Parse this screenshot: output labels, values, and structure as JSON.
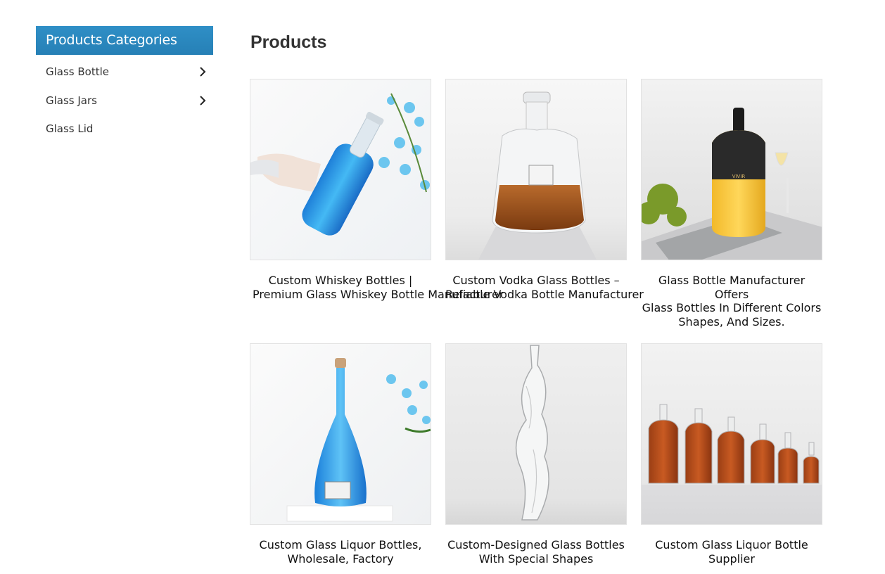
{
  "sidebar": {
    "title": "Products Categories",
    "items": [
      {
        "label": "Glass Bottle",
        "has_children": true
      },
      {
        "label": "Glass Jars",
        "has_children": true
      },
      {
        "label": "Glass Lid",
        "has_children": false
      }
    ]
  },
  "main": {
    "title": "Products",
    "products": [
      {
        "line1": "Custom Whiskey Bottles |",
        "line2": "Premium Glass Whiskey Bottle Manufacturer",
        "line3": "",
        "image": "blue-liquid-bottle-in-hand"
      },
      {
        "line1": "Custom Vodka Glass Bottles –",
        "line2": "Reliable Vodka Bottle Manufacturer",
        "line3": "",
        "image": "flat-decanter-with-amber-liquid"
      },
      {
        "line1": "Glass Bottle Manufacturer Offers",
        "line2": "Glass Bottles In Different Colors",
        "line3": "Shapes, And Sizes.",
        "image": "black-and-yellow-bottle-vivir"
      },
      {
        "line1": "Custom Glass Liquor Bottles,",
        "line2": "Wholesale, Factory",
        "line3": "",
        "image": "tall-blue-bottle-with-cork"
      },
      {
        "line1": "Custom-Designed Glass Bottles",
        "line2": "With Special Shapes",
        "line3": "",
        "image": "body-shaped-clear-bottle"
      },
      {
        "line1": "Custom Glass Liquor Bottle",
        "line2": "Supplier",
        "line3": "",
        "image": "row-of-amber-liquor-bottles"
      }
    ]
  },
  "colors": {
    "header_bg": "#2a86bd",
    "text": "#333333",
    "border": "#e2e2e2"
  },
  "icons": {
    "chevron": "chevron-right-icon"
  }
}
